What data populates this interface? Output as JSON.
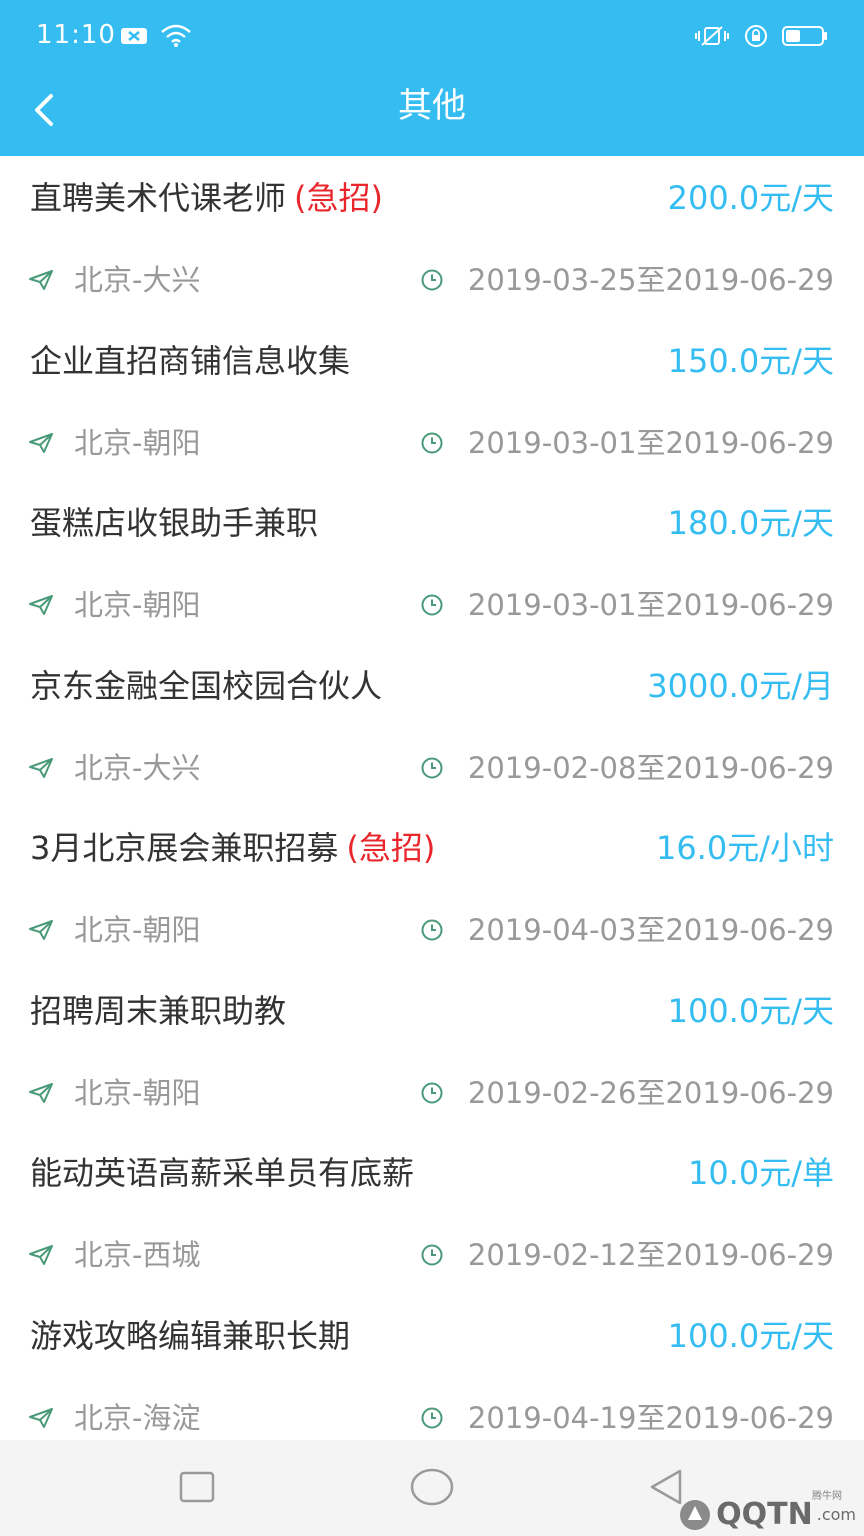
{
  "status_bar": {
    "time": "11:10"
  },
  "header": {
    "title": "其他"
  },
  "jobs": [
    {
      "title": "直聘美术代课老师",
      "urgent": "(急招)",
      "salary": "200.0元/天",
      "location": "北京-大兴",
      "date_range": "2019-03-25至2019-06-29"
    },
    {
      "title": "企业直招商铺信息收集",
      "urgent": "",
      "salary": "150.0元/天",
      "location": "北京-朝阳",
      "date_range": "2019-03-01至2019-06-29"
    },
    {
      "title": "蛋糕店收银助手兼职",
      "urgent": "",
      "salary": "180.0元/天",
      "location": "北京-朝阳",
      "date_range": "2019-03-01至2019-06-29"
    },
    {
      "title": "京东金融全国校园合伙人",
      "urgent": "",
      "salary": "3000.0元/月",
      "location": "北京-大兴",
      "date_range": "2019-02-08至2019-06-29"
    },
    {
      "title": "3月北京展会兼职招募",
      "urgent": "(急招)",
      "salary": "16.0元/小时",
      "location": "北京-朝阳",
      "date_range": "2019-04-03至2019-06-29"
    },
    {
      "title": "招聘周末兼职助教",
      "urgent": "",
      "salary": "100.0元/天",
      "location": "北京-朝阳",
      "date_range": "2019-02-26至2019-06-29"
    },
    {
      "title": "能动英语高薪采单员有底薪",
      "urgent": "",
      "salary": "10.0元/单",
      "location": "北京-西城",
      "date_range": "2019-02-12至2019-06-29"
    },
    {
      "title": "游戏攻略编辑兼职长期",
      "urgent": "",
      "salary": "100.0元/天",
      "location": "北京-海淀",
      "date_range": "2019-04-19至2019-06-29"
    }
  ],
  "watermark": {
    "text": "QQTN",
    "suffix": ".com",
    "sub": "腾牛网"
  },
  "colors": {
    "accent": "#35bdf2",
    "urgent": "#e8262b",
    "title_text": "#333333",
    "meta_text": "#999999",
    "icon": "#4a9a7a"
  },
  "icons": {
    "back": "chevron-left-icon",
    "location": "paper-plane-icon",
    "date": "clock-icon",
    "sys_recent": "square-icon",
    "sys_home": "circle-icon",
    "sys_back": "triangle-left-icon"
  }
}
